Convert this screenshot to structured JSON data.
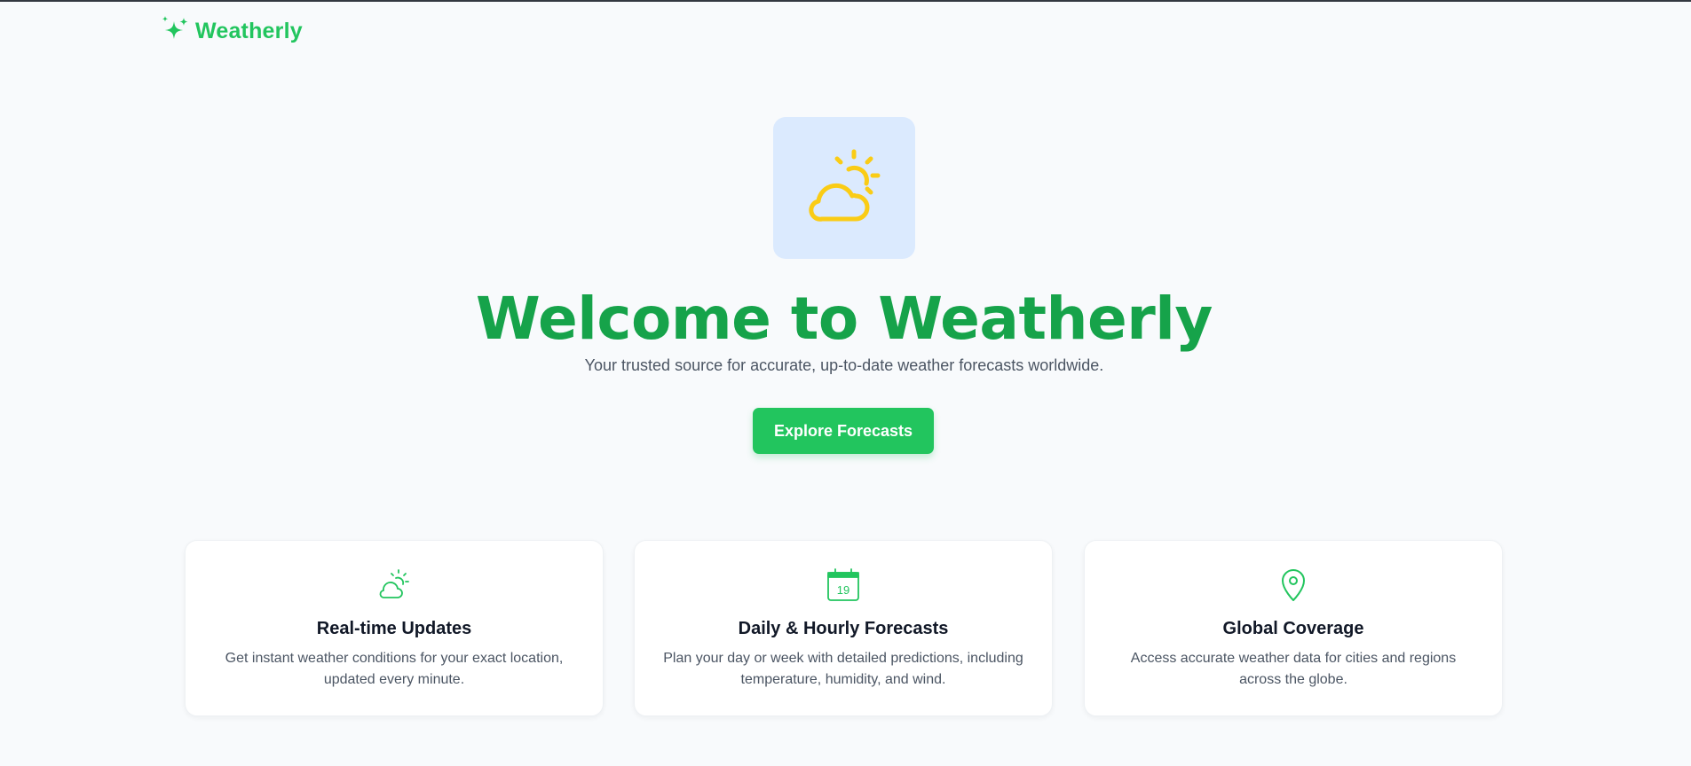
{
  "header": {
    "brand_name": "Weatherly",
    "brand_icon": "sparkles-icon"
  },
  "hero": {
    "icon": "partly-cloudy-icon",
    "title": "Welcome to Weatherly",
    "subtitle": "Your trusted source for accurate, up-to-date weather forecasts worldwide.",
    "cta_label": "Explore Forecasts"
  },
  "features": [
    {
      "icon": "partly-cloudy-icon",
      "title": "Real-time Updates",
      "description": "Get instant weather conditions for your exact location, updated every minute."
    },
    {
      "icon": "calendar-icon",
      "calendar_day": "19",
      "title": "Daily & Hourly Forecasts",
      "description": "Plan your day or week with detailed predictions, including temperature, humidity, and wind."
    },
    {
      "icon": "map-pin-icon",
      "title": "Global Coverage",
      "description": "Access accurate weather data for cities and regions across the globe."
    }
  ],
  "colors": {
    "brand_green": "#22c55e",
    "title_green": "#16a34a",
    "hero_icon_bg": "#dbeafe",
    "sun_yellow": "#facc15",
    "page_bg": "#f8fafc"
  }
}
